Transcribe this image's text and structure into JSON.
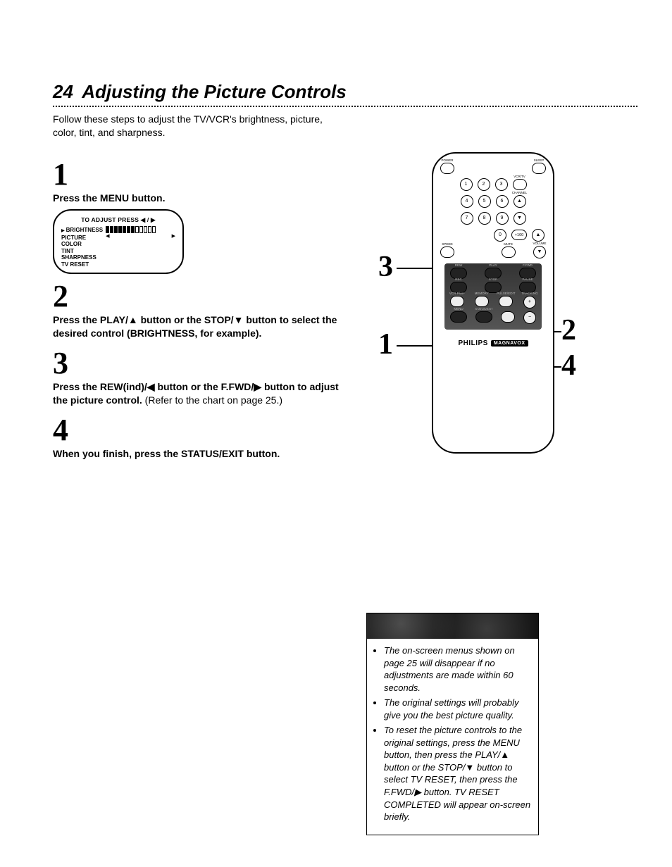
{
  "page_number": "24",
  "title": "Adjusting the Picture Controls",
  "intro": "Follow these steps to adjust the TV/VCR's brightness, picture, color, tint, and sharpness.",
  "steps": {
    "n1": "1",
    "s1": "Press the MENU button.",
    "n2": "2",
    "s2a": "Press the PLAY/▲ button or the STOP/▼ button to select the desired control (",
    "s2b": "BRIGHTNESS",
    "s2c": ", for example).",
    "n3": "3",
    "s3a": "Press the REW(ind)/◀ button or the F.FWD/▶ button to adjust the picture control.",
    "s3b": " (Refer to the chart on page 25.)",
    "n4": "4",
    "s4": "When you finish, press the STATUS/EXIT button."
  },
  "osd": {
    "title": "TO ADJUST PRESS ◀ / ▶",
    "items": [
      "BRIGHTNESS",
      "PICTURE",
      "COLOR",
      "TINT",
      "SHARPNESS",
      "TV RESET"
    ],
    "arrow_left": "◀",
    "arrow_right": "▶"
  },
  "remote": {
    "power": "POWER",
    "sleep": "SLEEP",
    "vcr_tv": "VCR/TV",
    "channel": "CHANNEL",
    "num1": "1",
    "num2": "2",
    "num3": "3",
    "num4": "4",
    "num5": "5",
    "num6": "6",
    "num7": "7",
    "num8": "8",
    "num9": "9",
    "num0": "0",
    "plus100": "+100",
    "speed": "SPEED",
    "mute": "MUTE",
    "volume": "VOLUME",
    "vcr_plus": "VCR Plus+",
    "memory": "MEMORY",
    "pulse_edit": "PULSE/EDIT",
    "tracking": "TRACKING",
    "rew": "REW",
    "play": "PLAY",
    "ffwd": "F.FWD",
    "menu": "MENU",
    "rec": "REC",
    "stop": "STOP",
    "pause": "PAUSE",
    "status_exit": "STATUS/EXIT",
    "brand": "PHILIPS",
    "brand2": "MAGNAVOX"
  },
  "callouts": {
    "c1": "1",
    "c2": "2",
    "c3": "3",
    "c4": "4"
  },
  "tips": {
    "t1": "The on-screen menus shown on page 25 will disappear if no adjustments are made within 60 seconds.",
    "t2": "The original settings will probably give you the best picture quality.",
    "t3": "To reset the picture controls to the original settings, press the MENU button, then press the PLAY/▲ button or the STOP/▼ button to select TV RESET, then press the F.FWD/▶ button. TV RESET COMPLETED will appear on-screen briefly."
  }
}
